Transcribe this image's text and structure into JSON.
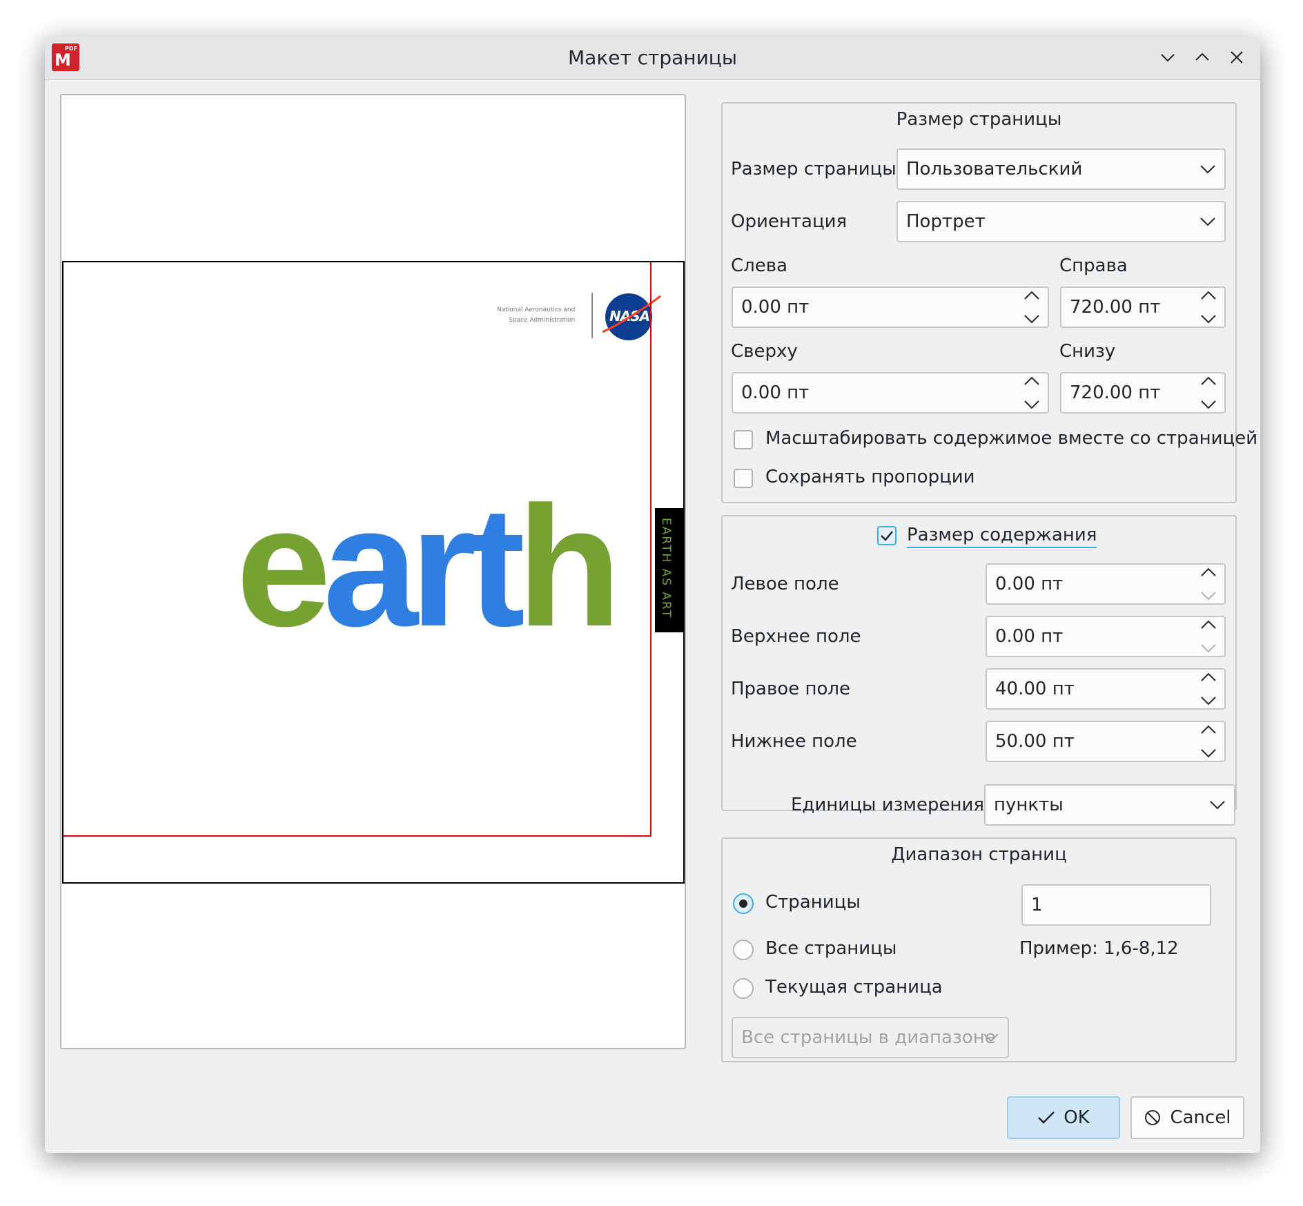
{
  "window": {
    "title": "Макет страницы",
    "app_icon_badge": "PDF",
    "app_icon_letter": "M"
  },
  "page_size_group": {
    "title": "Размер страницы",
    "page_size_label": "Размер страницы",
    "page_size_value": "Пользовательский",
    "orientation_label": "Ориентация",
    "orientation_value": "Портрет",
    "left_label": "Слева",
    "left_value": "0.00 пт",
    "right_label": "Справа",
    "right_value": "720.00 пт",
    "top_label": "Сверху",
    "top_value": "0.00 пт",
    "bottom_label": "Снизу",
    "bottom_value": "720.00 пт",
    "scale_content_label": "Масштабировать содержимое вместе со страницей",
    "scale_content_checked": false,
    "keep_ratio_label": "Сохранять пропорции",
    "keep_ratio_checked": false
  },
  "content_size_group": {
    "title": "Размер содержания",
    "checked": true,
    "left_margin_label": "Левое поле",
    "left_margin_value": "0.00 пт",
    "top_margin_label": "Верхнее поле",
    "top_margin_value": "0.00 пт",
    "right_margin_label": "Правое поле",
    "right_margin_value": "40.00 пт",
    "bottom_margin_label": "Нижнее поле",
    "bottom_margin_value": "50.00 пт"
  },
  "units": {
    "label": "Единицы измерения",
    "value": "пункты"
  },
  "page_range_group": {
    "title": "Диапазон страниц",
    "pages_label": "Страницы",
    "pages_value": "1",
    "all_pages_label": "Все страницы",
    "example_text": "Пример: 1,6-8,12",
    "current_page_label": "Текущая страница",
    "subset_value": "Все страницы в диапазоне",
    "selected": "pages"
  },
  "buttons": {
    "ok": "OK",
    "cancel": "Cancel"
  },
  "preview": {
    "nasa_line1": "National Aeronautics and",
    "nasa_line2": "Space Administration",
    "nasa_logo": "NASA",
    "earth_e": "e",
    "earth_art": "art",
    "earth_h": "h",
    "tab_text": "EARTH AS ART"
  },
  "colors": {
    "accent": "#3daee9",
    "margin_line": "#e00000",
    "earth_green": "#76a232",
    "earth_blue": "#2f7fe3"
  }
}
